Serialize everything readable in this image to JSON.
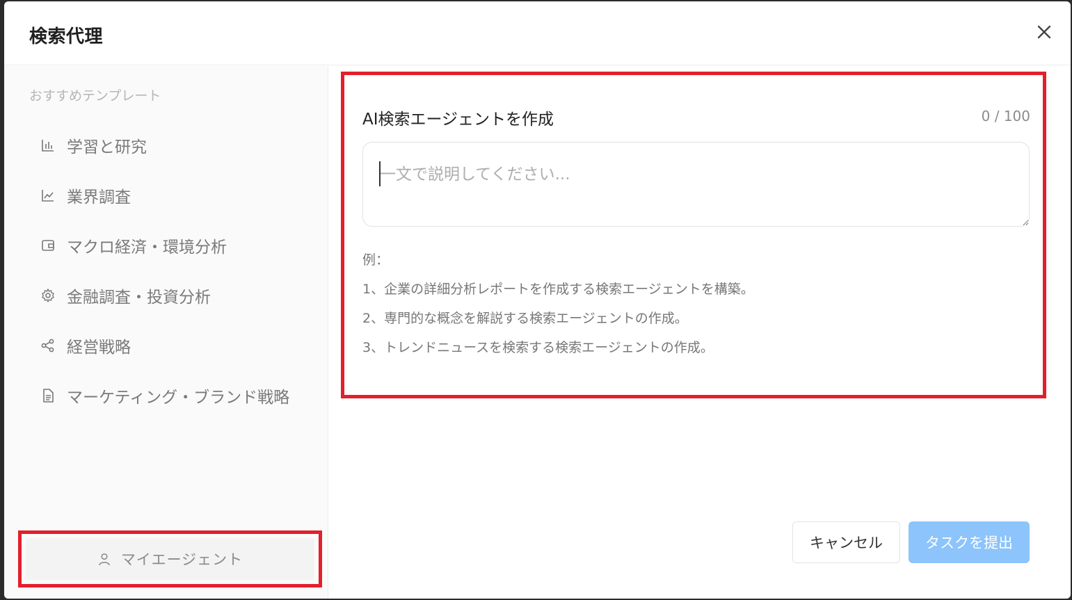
{
  "dialog": {
    "title": "検索代理",
    "close_icon": "close-icon"
  },
  "sidebar": {
    "heading": "おすすめテンプレート",
    "items": [
      {
        "label": "学習と研究",
        "icon": "bar-chart-icon"
      },
      {
        "label": "業界調査",
        "icon": "line-chart-icon"
      },
      {
        "label": "マクロ経済・環境分析",
        "icon": "wallet-icon"
      },
      {
        "label": "金融調査・投資分析",
        "icon": "gear-icon"
      },
      {
        "label": "経営戦略",
        "icon": "share-icon"
      },
      {
        "label": "マーケティング・ブランド戦略",
        "icon": "document-icon"
      }
    ],
    "my_agent": {
      "label": "マイエージェント",
      "icon": "user-icon"
    }
  },
  "main": {
    "create_label": "AI検索エージェントを作成",
    "counter": "0 / 100",
    "input": {
      "value": "",
      "placeholder": "一文で説明してください..."
    },
    "examples": [
      "例：",
      "1、企業の詳細分析レポートを作成する検索エージェントを構築。",
      "2、専門的な概念を解説する検索エージェントの作成。",
      "3、トレンドニュースを検索する検索エージェントの作成。"
    ]
  },
  "footer": {
    "cancel_label": "キャンセル",
    "submit_label": "タスクを提出"
  },
  "colors": {
    "highlight": "#e2202c",
    "submit_bg": "#8cc4fb",
    "muted_text": "#7a7a7a"
  }
}
